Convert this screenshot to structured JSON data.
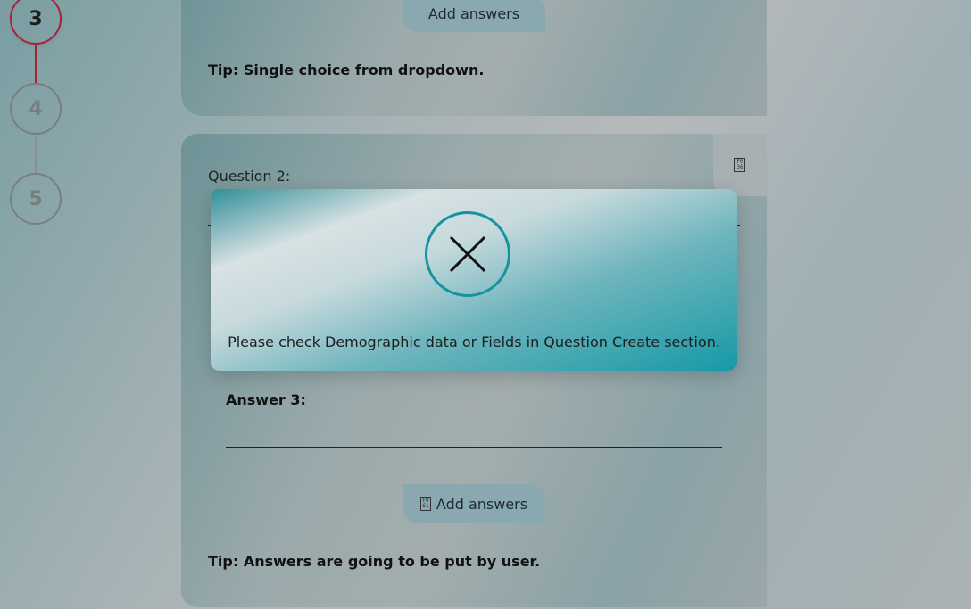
{
  "stepper": {
    "steps": [
      {
        "number": "3",
        "state": "active"
      },
      {
        "number": "4",
        "state": "inactive"
      },
      {
        "number": "5",
        "state": "inactive"
      }
    ],
    "colors": {
      "active": "#a8213a",
      "inactive": "#7b7d7f"
    }
  },
  "card1": {
    "add_answers_label": "Add answers",
    "tip": "Tip: Single choice from dropdown."
  },
  "card2": {
    "question_label": "Question 2:",
    "corner_icon": "fo36-glyph-icon",
    "answers": [
      {
        "label": "Answer 3:",
        "value": ""
      }
    ],
    "add_answers_label": "Add answers",
    "add_answers_icon": "fo61-glyph-icon",
    "tip": "Tip: Answers are going to be put by user."
  },
  "modal": {
    "icon": "error-x-icon",
    "message": "Please check Demographic data or Fields in Question Create section.",
    "accent": "#15939e"
  }
}
